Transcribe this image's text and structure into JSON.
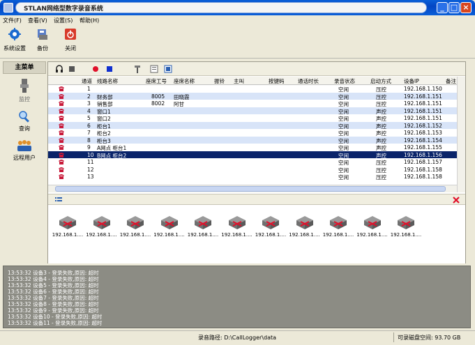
{
  "window": {
    "title": "STLAN网络型数字录音系统"
  },
  "menu": [
    "文件(F)",
    "查看(V)",
    "设置(S)",
    "帮助(H)"
  ],
  "toolbar": {
    "settings_label": "系统设置",
    "backup_label": "备份",
    "close_label": "关闭"
  },
  "sidebar": {
    "header": "主菜单",
    "items": [
      {
        "label": "监控",
        "icon": "monitor-icon"
      },
      {
        "label": "查询",
        "icon": "search-icon"
      },
      {
        "label": "远程用户",
        "icon": "users-icon"
      }
    ]
  },
  "grid": {
    "columns": [
      "通道",
      "线路名称",
      "座席工号",
      "座席名称",
      "振铃",
      "主叫",
      "按键码",
      "通话时长",
      "录音状态",
      "启动方式",
      "设备IP",
      "备注"
    ],
    "rows": [
      {
        "ch": "1",
        "name": "",
        "id": "",
        "agent": "",
        "status": "空闲",
        "mode": "压控",
        "ip": "192.168.1.150"
      },
      {
        "ch": "2",
        "name": "财务部",
        "id": "8005",
        "agent": "田晓霞",
        "status": "空闲",
        "mode": "压控",
        "ip": "192.168.1.151"
      },
      {
        "ch": "3",
        "name": "销售部",
        "id": "8002",
        "agent": "阿甘",
        "status": "空闲",
        "mode": "压控",
        "ip": "192.168.1.151"
      },
      {
        "ch": "4",
        "name": "窗口1",
        "id": "",
        "agent": "",
        "status": "空闲",
        "mode": "声控",
        "ip": "192.168.1.151"
      },
      {
        "ch": "5",
        "name": "窗口2",
        "id": "",
        "agent": "",
        "status": "空闲",
        "mode": "声控",
        "ip": "192.168.1.151"
      },
      {
        "ch": "6",
        "name": "柜台1",
        "id": "",
        "agent": "",
        "status": "空闲",
        "mode": "声控",
        "ip": "192.168.1.152"
      },
      {
        "ch": "7",
        "name": "柜台2",
        "id": "",
        "agent": "",
        "status": "空闲",
        "mode": "声控",
        "ip": "192.168.1.153"
      },
      {
        "ch": "8",
        "name": "柜台3",
        "id": "",
        "agent": "",
        "status": "空闲",
        "mode": "声控",
        "ip": "192.168.1.154"
      },
      {
        "ch": "9",
        "name": "A网点 柜台1",
        "id": "",
        "agent": "",
        "status": "空闲",
        "mode": "声控",
        "ip": "192.168.1.155"
      },
      {
        "ch": "10",
        "name": "B网点 柜台2",
        "id": "",
        "agent": "",
        "status": "空闲",
        "mode": "声控",
        "ip": "192.168.1.156"
      },
      {
        "ch": "11",
        "name": "",
        "id": "",
        "agent": "",
        "status": "空闲",
        "mode": "压控",
        "ip": "192.168.1.157"
      },
      {
        "ch": "12",
        "name": "",
        "id": "",
        "agent": "",
        "status": "空闲",
        "mode": "压控",
        "ip": "192.168.1.158"
      },
      {
        "ch": "13",
        "name": "",
        "id": "",
        "agent": "",
        "status": "空闲",
        "mode": "压控",
        "ip": "192.168.1.158"
      }
    ]
  },
  "devices": [
    "192.168.1....",
    "192.168.1....",
    "192.168.1....",
    "192.168.1....",
    "192.168.1....",
    "192.168.1....",
    "192.168.1....",
    "192.168.1....",
    "192.168.1....",
    "192.168.1....",
    "192.168.1...."
  ],
  "log": [
    "13:53:32  设备3 - 登录失败,原因: 超时",
    "13:53:32  设备4 - 登录失败,原因: 超时",
    "13:53:32  设备5 - 登录失败,原因: 超时",
    "13:53:32  设备6 - 登录失败,原因: 超时",
    "13:53:32  设备7 - 登录失败,原因: 超时",
    "13:53:32  设备8 - 登录失败,原因: 超时",
    "13:53:32  设备9 - 登录失败,原因: 超时",
    "13:53:32  设备10 - 登录失败,原因: 超时",
    "13:53:32  设备11 - 登录失败,原因: 超时"
  ],
  "status": {
    "path": "录音路径: D:\\CallLogger\\data",
    "disk": "可录磁盘空间: 93.70 GB"
  },
  "colors": {
    "selected_row": "#0a246a",
    "alt_row": "#d8e4f8",
    "record": "#e0102a",
    "stop": "#1030d0"
  }
}
